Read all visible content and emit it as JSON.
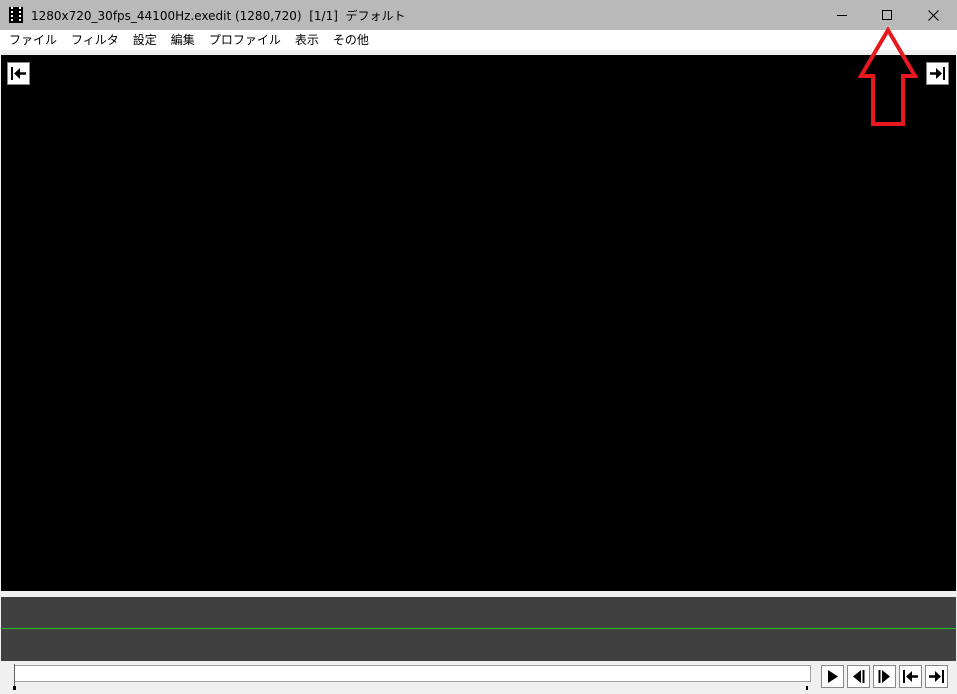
{
  "window": {
    "title": "1280x720_30fps_44100Hz.exedit (1280,720)  [1/1]  デフォルト",
    "icon": "film-strip-icon"
  },
  "title_buttons": {
    "minimize": "minimize-icon",
    "maximize": "maximize-icon",
    "close": "close-icon"
  },
  "menu": {
    "items": [
      "ファイル",
      "フィルタ",
      "設定",
      "編集",
      "プロファイル",
      "表示",
      "その他"
    ]
  },
  "preview": {
    "jump_left_icon": "jump-to-start-icon",
    "jump_right_icon": "jump-to-end-icon"
  },
  "timeline": {
    "seek_position": 0,
    "track_line_color": "#22c022"
  },
  "playback": {
    "buttons": [
      "play-icon",
      "prev-frame-icon",
      "next-frame-icon",
      "go-start-icon",
      "go-end-icon"
    ]
  },
  "colors": {
    "titlebar": "#b9b9b9",
    "preview": "#000000",
    "track": "#404040",
    "annotation": "#e8191e"
  }
}
